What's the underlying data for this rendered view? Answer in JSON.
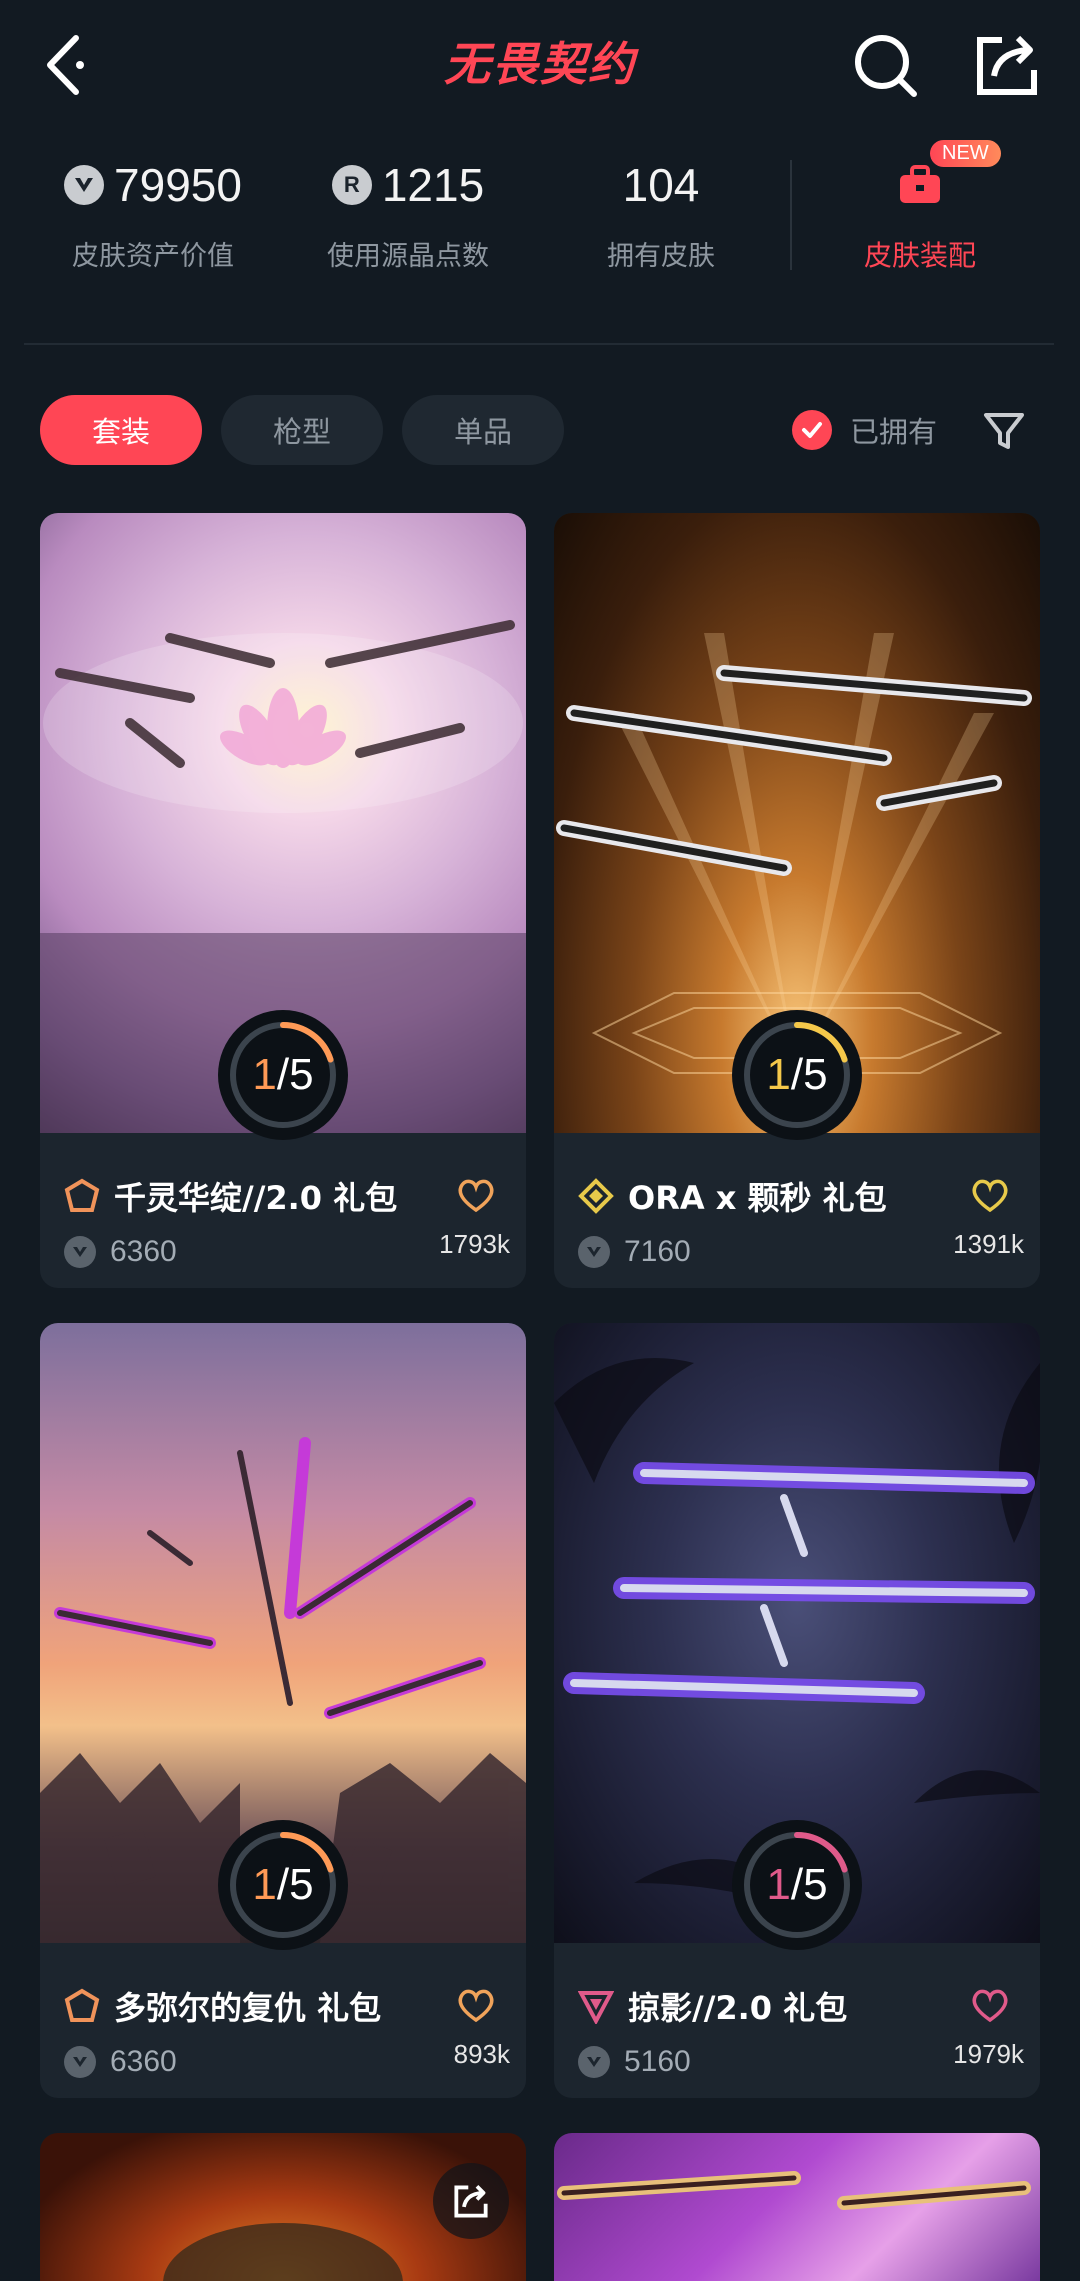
{
  "header": {
    "title": "无畏契约"
  },
  "stats": [
    {
      "value": "79950",
      "label": "皮肤资产价值",
      "icon": "valorant-points-icon"
    },
    {
      "value": "1215",
      "label": "使用源晶点数",
      "icon": "radianite-icon"
    },
    {
      "value": "104",
      "label": "拥有皮肤"
    }
  ],
  "equip": {
    "label": "皮肤装配",
    "badge": "NEW"
  },
  "tabs": [
    {
      "label": "套装",
      "active": true
    },
    {
      "label": "枪型",
      "active": false
    },
    {
      "label": "单品",
      "active": false
    }
  ],
  "owned_label": "已拥有",
  "cards": [
    {
      "title": "千灵华绽//2.0 礼包",
      "price": "6360",
      "likes": "1793k",
      "progress": "1",
      "total": "5",
      "progress_fraction": 0.2,
      "tier_color": "#f0935a",
      "heart_color": "#f0a35a",
      "ring_color": "#ff9a56"
    },
    {
      "title": "ORA x 颗秒 礼包",
      "price": "7160",
      "likes": "1391k",
      "progress": "1",
      "total": "5",
      "progress_fraction": 0.2,
      "tier_color": "#e7c94a",
      "heart_color": "#e7c94a",
      "ring_color": "#f5c84a"
    },
    {
      "title": "多弥尔的复仇 礼包",
      "price": "6360",
      "likes": "893k",
      "progress": "1",
      "total": "5",
      "progress_fraction": 0.2,
      "tier_color": "#f0935a",
      "heart_color": "#f0a35a",
      "ring_color": "#ff9a56"
    },
    {
      "title": "掠影//2.0 礼包",
      "price": "5160",
      "likes": "1979k",
      "progress": "1",
      "total": "5",
      "progress_fraction": 0.2,
      "tier_color": "#e05a8a",
      "heart_color": "#e05a8a",
      "ring_color": "#e05a8a"
    }
  ]
}
